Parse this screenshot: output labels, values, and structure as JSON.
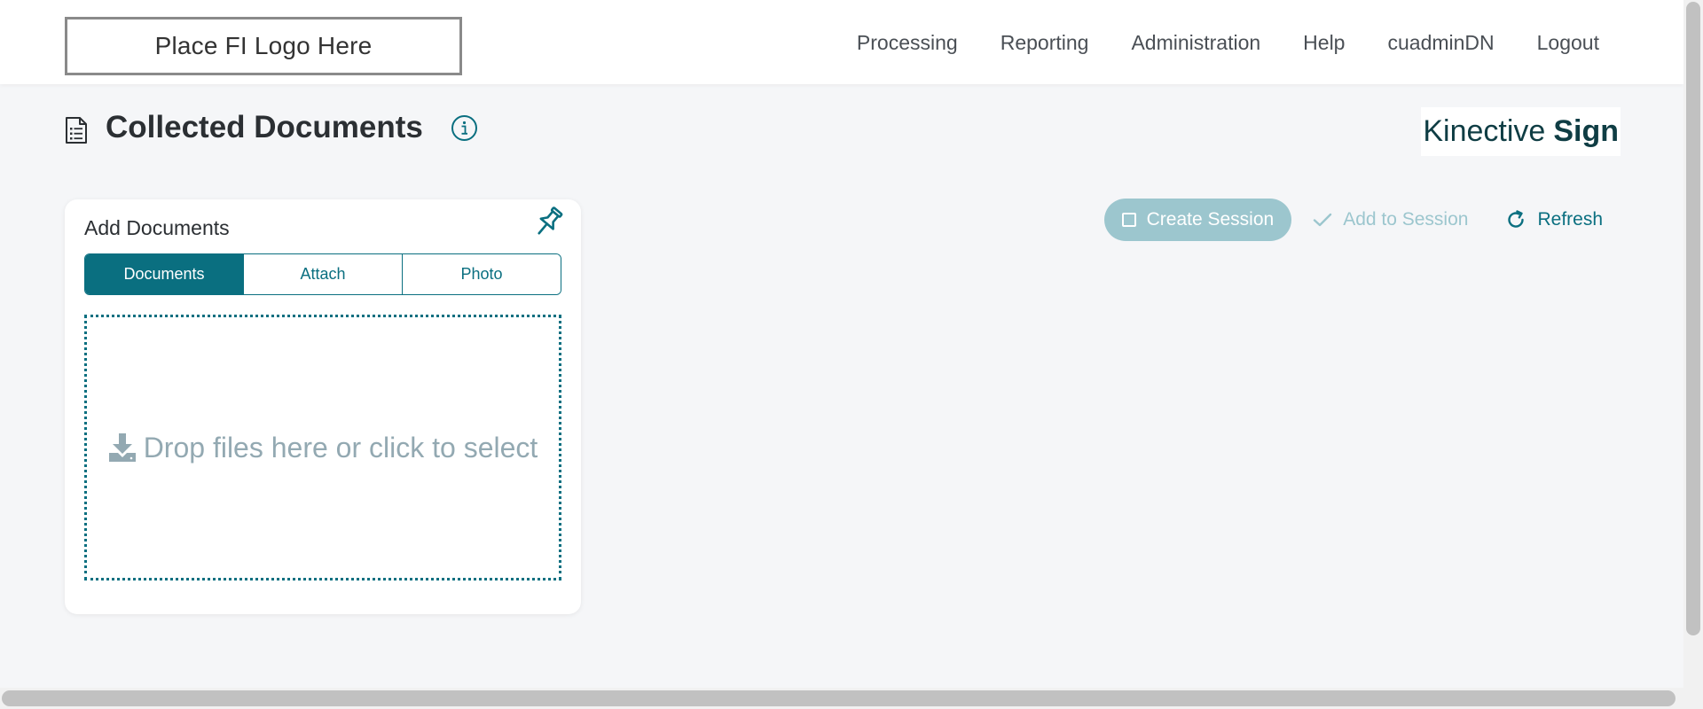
{
  "header": {
    "logo_text": "Place FI Logo Here",
    "nav": [
      {
        "label": "Processing"
      },
      {
        "label": "Reporting"
      },
      {
        "label": "Administration"
      },
      {
        "label": "Help"
      },
      {
        "label": "cuadminDN"
      },
      {
        "label": "Logout"
      }
    ]
  },
  "page": {
    "title": "Collected Documents",
    "title_icon": "document-list-icon",
    "info_icon": "info-icon",
    "brand": {
      "regular": "Kinective",
      "bold": "Sign"
    }
  },
  "actions": {
    "create_session_label": "Create Session",
    "add_to_session_label": "Add to Session",
    "refresh_label": "Refresh"
  },
  "add_documents": {
    "title": "Add Documents",
    "pin_icon": "pin-icon",
    "tabs": [
      {
        "label": "Documents",
        "active": true
      },
      {
        "label": "Attach",
        "active": false
      },
      {
        "label": "Photo",
        "active": false
      }
    ],
    "dropzone_text": "Drop files here or click to select",
    "dropzone_icon": "download-icon"
  },
  "colors": {
    "accent": "#0a6f80",
    "accent_muted": "#9cc6ce",
    "brand_text": "#0f3d44",
    "page_bg": "#f5f6f8",
    "dropzone_text": "#93a9b2"
  }
}
